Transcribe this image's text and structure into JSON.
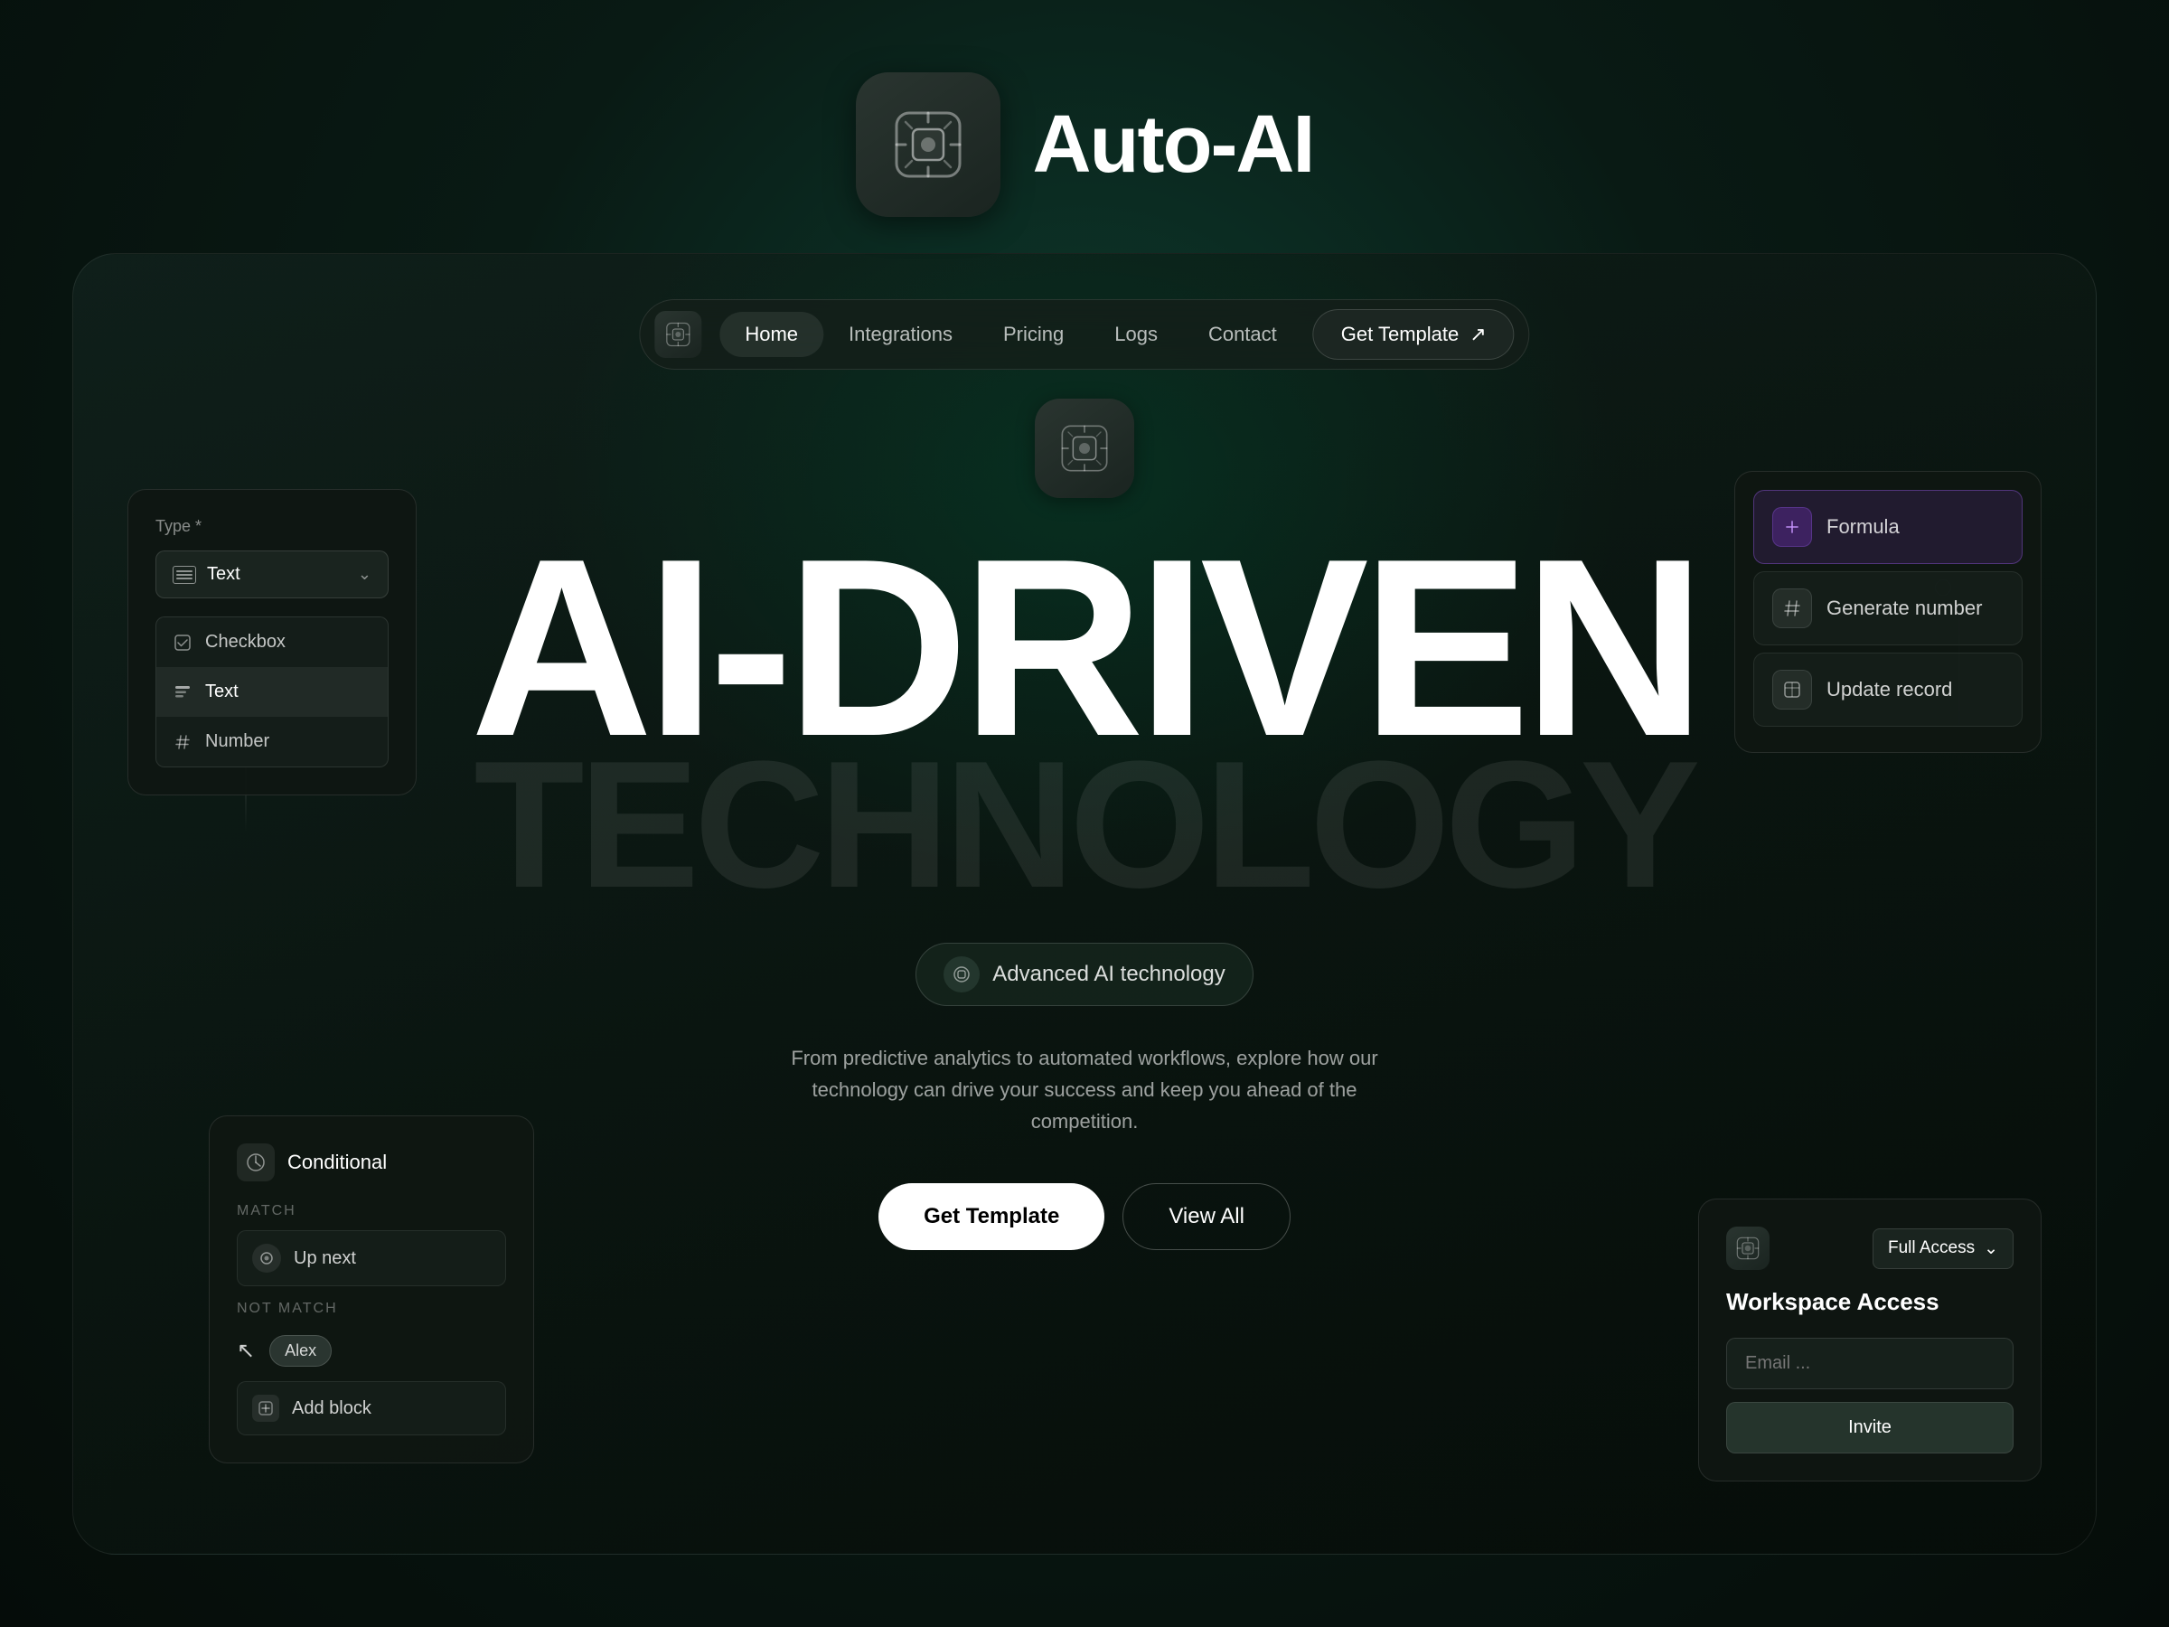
{
  "brand": {
    "title": "Auto-AI",
    "logo_alt": "Auto-AI logo"
  },
  "navbar": {
    "items": [
      {
        "label": "Home",
        "active": true
      },
      {
        "label": "Integrations",
        "active": false
      },
      {
        "label": "Pricing",
        "active": false
      },
      {
        "label": "Logs",
        "active": false
      },
      {
        "label": "Contact",
        "active": false
      }
    ],
    "cta_label": "Get Template",
    "cta_icon": "↗"
  },
  "hero": {
    "title_main": "AI-DRIVEN",
    "title_sub": "TECHNOLOGY",
    "badge_text": "Advanced AI technology",
    "description": "From predictive analytics to automated workflows, explore how our technology can drive your success and keep you ahead of the competition.",
    "btn_primary": "Get Template",
    "btn_secondary": "View All"
  },
  "type_selector": {
    "label": "Type *",
    "selected": "Text",
    "options": [
      {
        "label": "Checkbox",
        "icon": "checkbox"
      },
      {
        "label": "Text",
        "icon": "text",
        "selected": true
      },
      {
        "label": "Number",
        "icon": "hash"
      }
    ]
  },
  "conditional": {
    "title": "Conditional",
    "match_label": "MATCH",
    "match_item": "Up next",
    "not_match_label": "NOT MATCH",
    "not_match_user": "Alex",
    "add_block_label": "Add block"
  },
  "formula_card": {
    "items": [
      {
        "label": "Formula",
        "icon": "+",
        "active": true
      },
      {
        "label": "Generate number",
        "icon": "#",
        "active": false
      },
      {
        "label": "Update record",
        "icon": "⊞",
        "active": false
      }
    ]
  },
  "workspace": {
    "access_label": "Full Access",
    "title": "Workspace Access",
    "email_placeholder": "Email ...",
    "invite_label": "Invite"
  }
}
